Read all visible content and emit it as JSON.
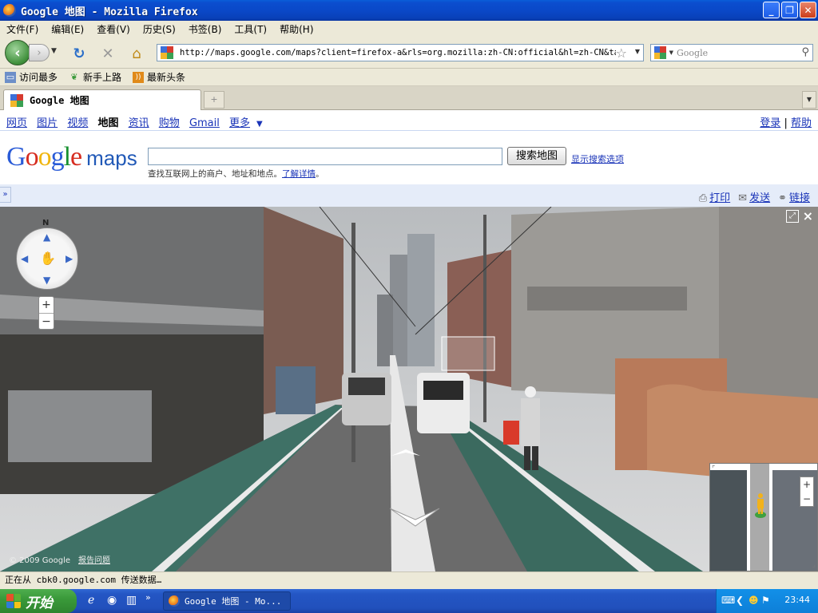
{
  "window": {
    "title": "Google 地图 - Mozilla Firefox",
    "controls": [
      "minimize",
      "maximize",
      "close"
    ]
  },
  "menu": {
    "items": [
      "文件(F)",
      "编辑(E)",
      "查看(V)",
      "历史(S)",
      "书签(B)",
      "工具(T)",
      "帮助(H)"
    ]
  },
  "navbar": {
    "url": "http://maps.google.com/maps?client=firefox-a&rls=org.mozilla:zh-CN:official&hl=zh-CN&tab=w",
    "search_placeholder": "Google"
  },
  "bookmarks": {
    "items": [
      "访问最多",
      "新手上路",
      "最新头条"
    ]
  },
  "tabs": {
    "active_title": "Google 地图",
    "new_tab": "+"
  },
  "gbar": {
    "links": [
      "网页",
      "图片",
      "视频",
      "地图",
      "资讯",
      "购物",
      "Gmail",
      "更多"
    ],
    "active": "地图",
    "more_caret": "▼",
    "login": "登录",
    "help": "帮助",
    "separator": "|"
  },
  "maps": {
    "logo_maps": "maps",
    "search_button": "搜索地图",
    "show_options": "显示搜索选项",
    "hint_text": "查找互联网上的商户、地址和地点。",
    "hint_link": "了解详情",
    "hint_end": "。"
  },
  "actions": {
    "collapse": "»",
    "print": "打印",
    "send": "发送",
    "link": "链接"
  },
  "streetview": {
    "compass_north": "N",
    "zoom_in": "+",
    "zoom_out": "−",
    "copyright": "© 2009 Google",
    "report": "报告问题",
    "close": "×"
  },
  "status": {
    "text": "正在从 cbk0.google.com 传送数据…"
  },
  "taskbar": {
    "start": "开始",
    "task_title": "Google 地图 - Mo...",
    "clock": "23:44",
    "overflow": "»"
  },
  "colors": {
    "xp_blue": "#0a48c8",
    "link_blue": "#1a34b8",
    "action_bar": "#e5ecf9",
    "start_green": "#3a9a3a"
  }
}
